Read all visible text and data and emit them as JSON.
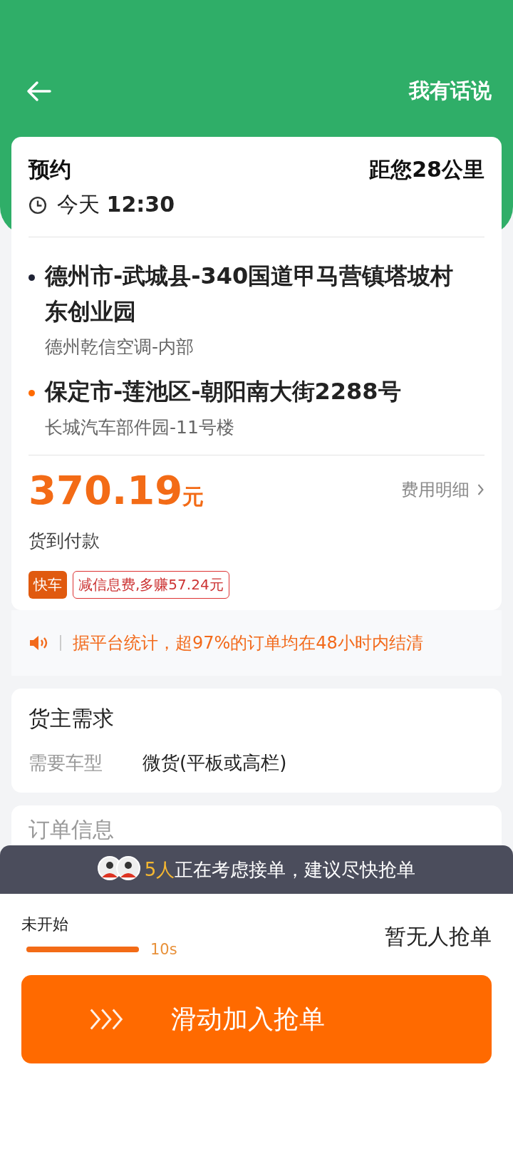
{
  "header": {
    "action": "我有话说"
  },
  "order": {
    "type": "预约",
    "distance": "距您28公里",
    "date": "今天",
    "time": "12:30"
  },
  "stops": [
    {
      "address": "德州市-武城县-340国道甲马营镇塔坡村东创业园",
      "detail": "德州乾信空调-内部",
      "color": "#1f2235"
    },
    {
      "address": "保定市-莲池区-朝阳南大街2288号",
      "detail": "长城汽车部件园-11号楼",
      "color": "#ff6a00"
    }
  ],
  "price": {
    "amount": "370.19",
    "unit": "元",
    "details_link": "费用明细",
    "payment": "货到付款"
  },
  "tags": [
    {
      "kind": "solid",
      "text": "快车"
    },
    {
      "kind": "outline",
      "text": "减信息费,多赚57.24元"
    }
  ],
  "notice": "据平台统计，超97%的订单均在48小时内结清",
  "requirements": {
    "title": "货主需求",
    "rows": [
      {
        "label": "需要车型",
        "value": "微货(平板或高栏)"
      }
    ]
  },
  "order_info": {
    "title": "订单信息"
  },
  "banner": {
    "count": "5人",
    "text": "正在考虑接单，建议尽快抢单"
  },
  "timer": {
    "status": "未开始",
    "level": 1,
    "seconds": "10s",
    "grab_status": "暂无人抢单"
  },
  "slide_button": "滑动加入抢单"
}
